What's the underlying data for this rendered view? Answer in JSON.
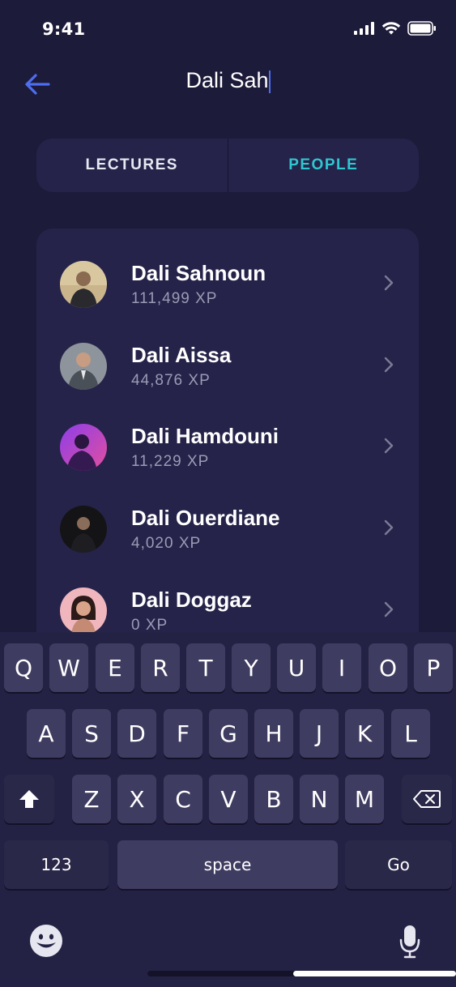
{
  "status": {
    "time": "9:41"
  },
  "search": {
    "query": "Dali Sah"
  },
  "tabs": [
    {
      "label": "LECTURES",
      "active": false
    },
    {
      "label": "PEOPLE",
      "active": true
    }
  ],
  "people": [
    {
      "name": "Dali Sahnoun",
      "xp": "111,499 XP"
    },
    {
      "name": "Dali Aissa",
      "xp": "44,876 XP"
    },
    {
      "name": "Dali Hamdouni",
      "xp": "11,229 XP"
    },
    {
      "name": "Dali Ouerdiane",
      "xp": "4,020 XP"
    },
    {
      "name": "Dali Doggaz",
      "xp": "0 XP"
    }
  ],
  "keyboard": {
    "row1": [
      "Q",
      "W",
      "E",
      "R",
      "T",
      "Y",
      "U",
      "I",
      "O",
      "P"
    ],
    "row2": [
      "A",
      "S",
      "D",
      "F",
      "G",
      "H",
      "J",
      "K",
      "L"
    ],
    "row3": [
      "Z",
      "X",
      "C",
      "V",
      "B",
      "N",
      "M"
    ],
    "numbers_label": "123",
    "space_label": "space",
    "go_label": "Go"
  },
  "colors": {
    "accent": "#2fc7cf",
    "back_arrow": "#4d6ef0",
    "background": "#1d1b3a",
    "card": "#252349"
  }
}
